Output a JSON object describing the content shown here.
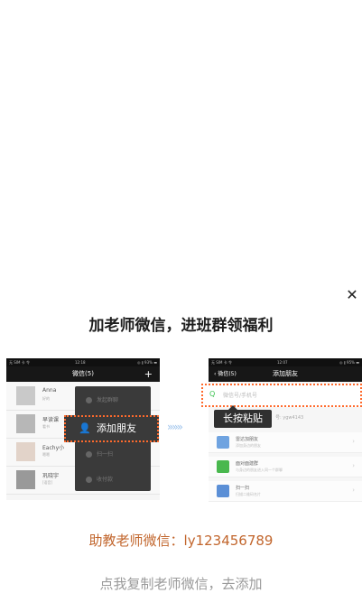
{
  "dialog": {
    "close_icon": "close-icon",
    "title": "加老师微信，进班群领福利",
    "assistant_label": "助教老师微信：ly123456789",
    "copy_hint": "点我复制老师微信，去添加"
  },
  "left_phone": {
    "status_carrier": "无 SIM 卡 令",
    "status_time": "12:18",
    "status_battery": "◎ ∦ 93% ▬",
    "nav_title": "微信(5)",
    "nav_plus": "+",
    "chats": [
      {
        "name": "Anna",
        "sub": "好的"
      },
      {
        "name": "早读课",
        "sub": "看书"
      },
      {
        "name": "Eachy小",
        "sub": "嗯嗯"
      },
      {
        "name": "巩晓宇",
        "sub": "[语音]"
      }
    ],
    "menu": [
      {
        "label": "发起群聊"
      },
      {
        "label": "扫一扫"
      },
      {
        "label": "收付款"
      }
    ],
    "highlight_label": "添加朋友",
    "highlight_icon": "add-friend-icon"
  },
  "arrows": "»»»",
  "right_phone": {
    "status_carrier": "无 SIM 卡 令",
    "status_time": "12:07",
    "status_battery": "◎ ∦ 95% ▬",
    "back_label": "微信(5)",
    "nav_title": "添加朋友",
    "search_placeholder": "微信号/手机号",
    "tooltip": "长按粘贴",
    "my_id": "号: ygw4143",
    "options": [
      {
        "title": "雷达加朋友",
        "sub": "添加身边的朋友",
        "color": "#6fa3e0"
      },
      {
        "title": "面对面建群",
        "sub": "与身边的朋友进入同一个群聊",
        "color": "#49b84e"
      },
      {
        "title": "扫一扫",
        "sub": "扫描二维码名片",
        "color": "#5b8fd6"
      }
    ]
  },
  "colors": {
    "accent": "#c2662d",
    "highlight_border": "#ff6a2c"
  }
}
